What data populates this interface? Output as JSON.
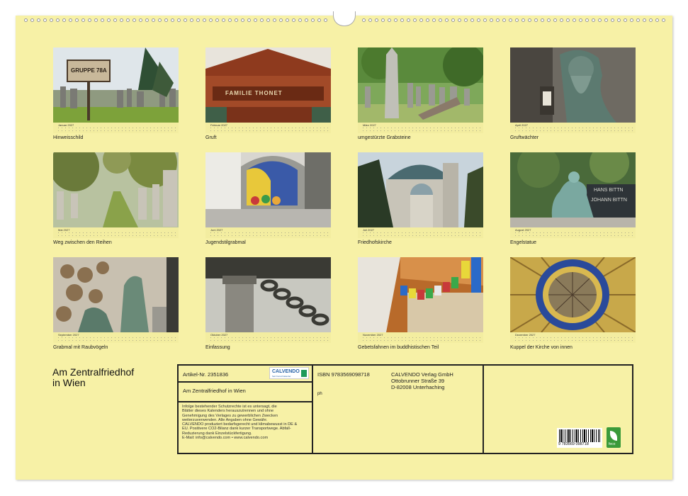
{
  "months": [
    {
      "label": "Januar 2027",
      "caption": "Hinweisschild"
    },
    {
      "label": "Februar 2027",
      "caption": "Gruft"
    },
    {
      "label": "März 2027",
      "caption": "umgestürzte Grabsteine"
    },
    {
      "label": "April 2027",
      "caption": "Gruftwächter"
    },
    {
      "label": "Mai 2027",
      "caption": "Weg zwischen den Reihen"
    },
    {
      "label": "Juni 2027",
      "caption": "Jugendstilgrabmal"
    },
    {
      "label": "Juli 2027",
      "caption": "Friedhofskirche"
    },
    {
      "label": "August 2027",
      "caption": "Engelstatue"
    },
    {
      "label": "September 2027",
      "caption": "Grabmal mit Raubvögeln"
    },
    {
      "label": "Oktober 2027",
      "caption": "Einfassung"
    },
    {
      "label": "November 2027",
      "caption": "Gebetsfahnen im buddhistischen Teil"
    },
    {
      "label": "Dezember 2027",
      "caption": "Kuppel der Kirche von innen"
    }
  ],
  "photo_text": {
    "sign": "GRUPPE 78A",
    "crypt": "FAMILIE THONET",
    "grave_name_1": "HANS BITTN",
    "grave_name_2": "JOHANN BITTN"
  },
  "title_line1": "Am Zentralfriedhof",
  "title_line2": "in Wien",
  "info": {
    "article": "Artikel-Nr. 2351836",
    "logo_text": "CALVENDO",
    "logo_sub": "Seit Kunst Kalender",
    "subtitle": "Am Zentralfriedhof in Wien",
    "legal": [
      "Infolge bestehender Schutzrechte ist es untersagt, die",
      "Blätter dieses Kalenders herauszutrennen und ohne",
      "Genehmigung des Verlages zu gewerblichen Zwecken",
      "weiterzuverwenden. Alle Angaben ohne Gewähr.",
      "CALVENDO produziert bedarfsgerecht und klimabewusst in DE &",
      "EU. Positivere CO2-Bilanz dank kurzer Transportwege. Abfall-",
      "Reduzierung dank Einzelstückfertigung.",
      "E-Mail: info@calvendo.com • www.calvendo.com"
    ],
    "isbn": "ISBN 9783569098718",
    "ph": "ph",
    "publisher": "CALVENDO Verlag GmbH",
    "street": "Ottobrunner Straße 39",
    "city": "D-82008 Unterhaching",
    "barcode_number": "9 783569 098718",
    "feco_label": "feco"
  }
}
